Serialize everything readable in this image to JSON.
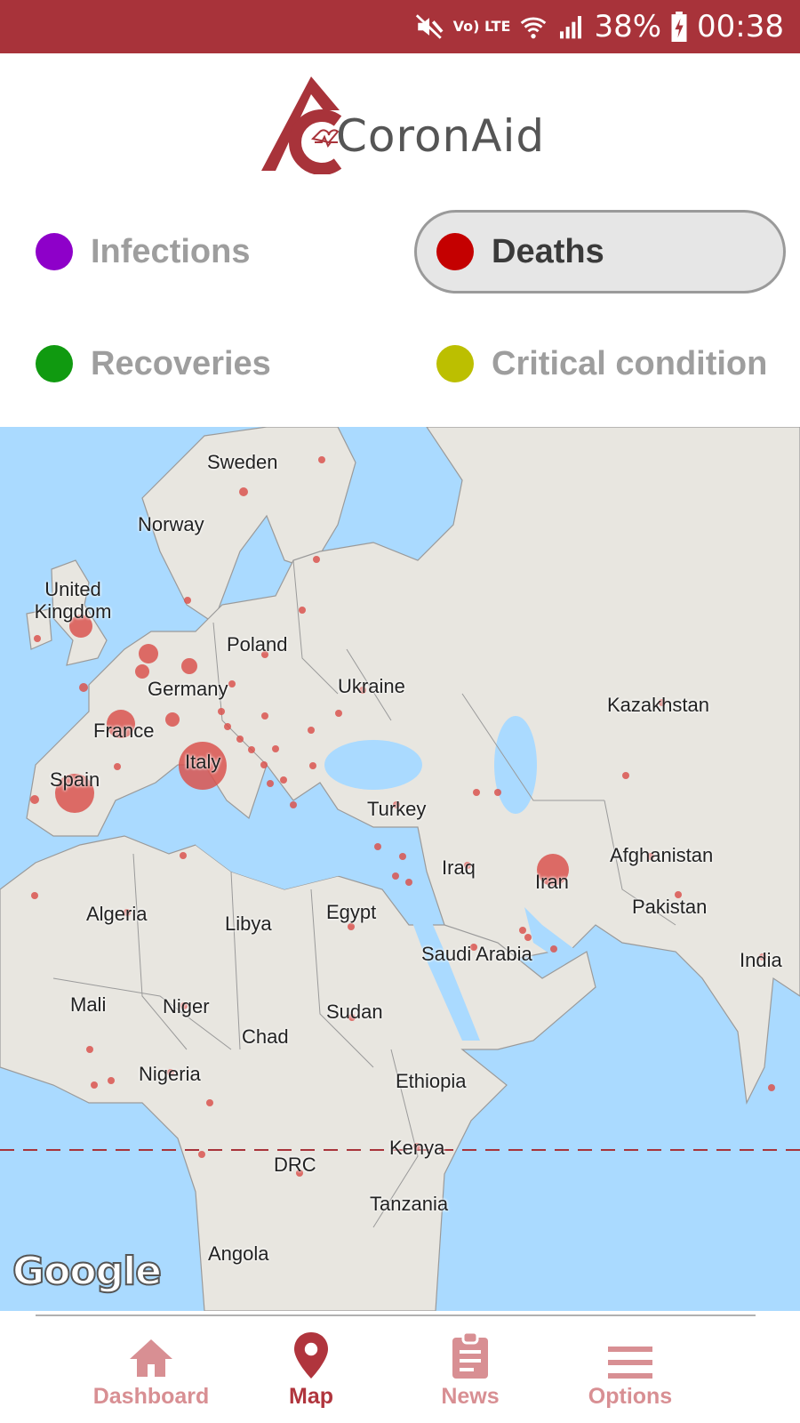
{
  "status_bar": {
    "battery": "38%",
    "time": "00:38",
    "network_label": "Vo) LTE",
    "icons": [
      "mute-icon",
      "volte-icon",
      "wifi-icon",
      "signal-icon",
      "battery-charging-icon"
    ]
  },
  "app": {
    "name": "CoronAid"
  },
  "filters": [
    {
      "label": "Infections",
      "color": "#8e00c9",
      "active": false
    },
    {
      "label": "Deaths",
      "color": "#c40000",
      "active": true
    },
    {
      "label": "Recoveries",
      "color": "#109a10",
      "active": false
    },
    {
      "label": "Critical condition",
      "color": "#bcbf00",
      "active": false
    }
  ],
  "map": {
    "attribution": "Google",
    "labels": [
      "Sweden",
      "Norway",
      "United Kingdom",
      "Poland",
      "Germany",
      "Ukraine",
      "Kazakhstan",
      "France",
      "Italy",
      "Spain",
      "Turkey",
      "Afghanistan",
      "Iraq",
      "Iran",
      "Pakistan",
      "Algeria",
      "Libya",
      "Egypt",
      "Saudi Arabia",
      "India",
      "Mali",
      "Niger",
      "Sudan",
      "Chad",
      "Nigeria",
      "Ethiopia",
      "Kenya",
      "DRC",
      "Tanzania",
      "Angola"
    ],
    "marker_color": "#d9534f"
  },
  "nav": [
    {
      "label": "Dashboard",
      "icon": "home-icon",
      "active": false
    },
    {
      "label": "Map",
      "icon": "map-pin-icon",
      "active": true
    },
    {
      "label": "News",
      "icon": "clipboard-icon",
      "active": false
    },
    {
      "label": "Options",
      "icon": "menu-icon",
      "active": false
    }
  ]
}
